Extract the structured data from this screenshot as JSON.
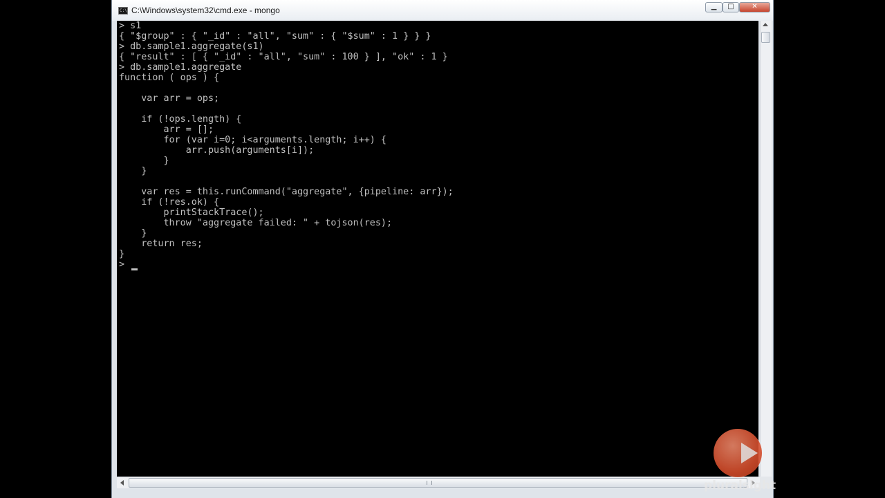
{
  "window": {
    "title": "C:\\Windows\\system32\\cmd.exe - mongo",
    "icon_label": "C:\\",
    "controls": {
      "minimize": "▁",
      "maximize": "□",
      "close": "✕"
    }
  },
  "console": {
    "text_color": "#c0c0c0",
    "background": "#000000",
    "lines": [
      "> s1",
      "{ \"$group\" : { \"_id\" : \"all\", \"sum\" : { \"$sum\" : 1 } } }",
      "> db.sample1.aggregate(s1)",
      "{ \"result\" : [ { \"_id\" : \"all\", \"sum\" : 100 } ], \"ok\" : 1 }",
      "> db.sample1.aggregate",
      "function ( ops ) {",
      "",
      "    var arr = ops;",
      "",
      "    if (!ops.length) {",
      "        arr = [];",
      "        for (var i=0; i<arguments.length; i++) {",
      "            arr.push(arguments[i]);",
      "        }",
      "    }",
      "",
      "    var res = this.runCommand(\"aggregate\", {pipeline: arr});",
      "    if (!res.ok) {",
      "        printStackTrace();",
      "        throw \"aggregate failed: \" + tojson(res);",
      "    }",
      "    return res;",
      "}",
      "> "
    ]
  },
  "watermark": {
    "brand": "pluralsight",
    "accent": "#d94f2d"
  }
}
